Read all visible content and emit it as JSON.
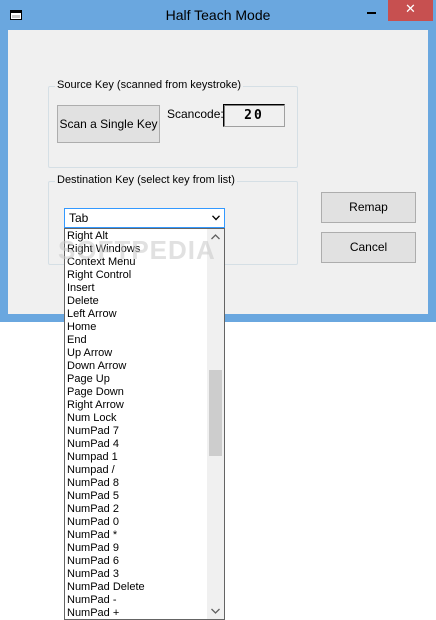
{
  "window": {
    "title": "Half Teach Mode",
    "close_glyph": "✕"
  },
  "source_group": {
    "title": "Source Key (scanned from keystroke)",
    "scan_button": "Scan a Single Key",
    "scancode_label": "Scancode:",
    "scancode_value": "20"
  },
  "destination_group": {
    "title": "Destination Key (select key from list)",
    "selected": "Tab"
  },
  "buttons": {
    "remap": "Remap",
    "cancel": "Cancel"
  },
  "dropdown_items": [
    "Right Alt",
    "Right Windows",
    "Context Menu",
    "Right Control",
    "Insert",
    "Delete",
    "Left Arrow",
    "Home",
    "End",
    "Up Arrow",
    "Down Arrow",
    "Page Up",
    "Page Down",
    "Right Arrow",
    "Num Lock",
    "NumPad 7",
    "NumPad 4",
    "Numpad 1",
    "Numpad /",
    "NumPad 8",
    "NumPad 5",
    "NumPad 2",
    "NumPad 0",
    "NumPad *",
    "NumPad 9",
    "NumPad 6",
    "NumPad 3",
    "NumPad Delete",
    "NumPad -",
    "NumPad +"
  ],
  "scrollbar": {
    "position_fraction": 0.46
  },
  "watermark": "SOFTPEDIA",
  "colors": {
    "titlebar": "#6aa7df",
    "close_button": "#c75050",
    "dialog_bg": "#f0f0f0",
    "combo_focus_border": "#3399ff"
  }
}
